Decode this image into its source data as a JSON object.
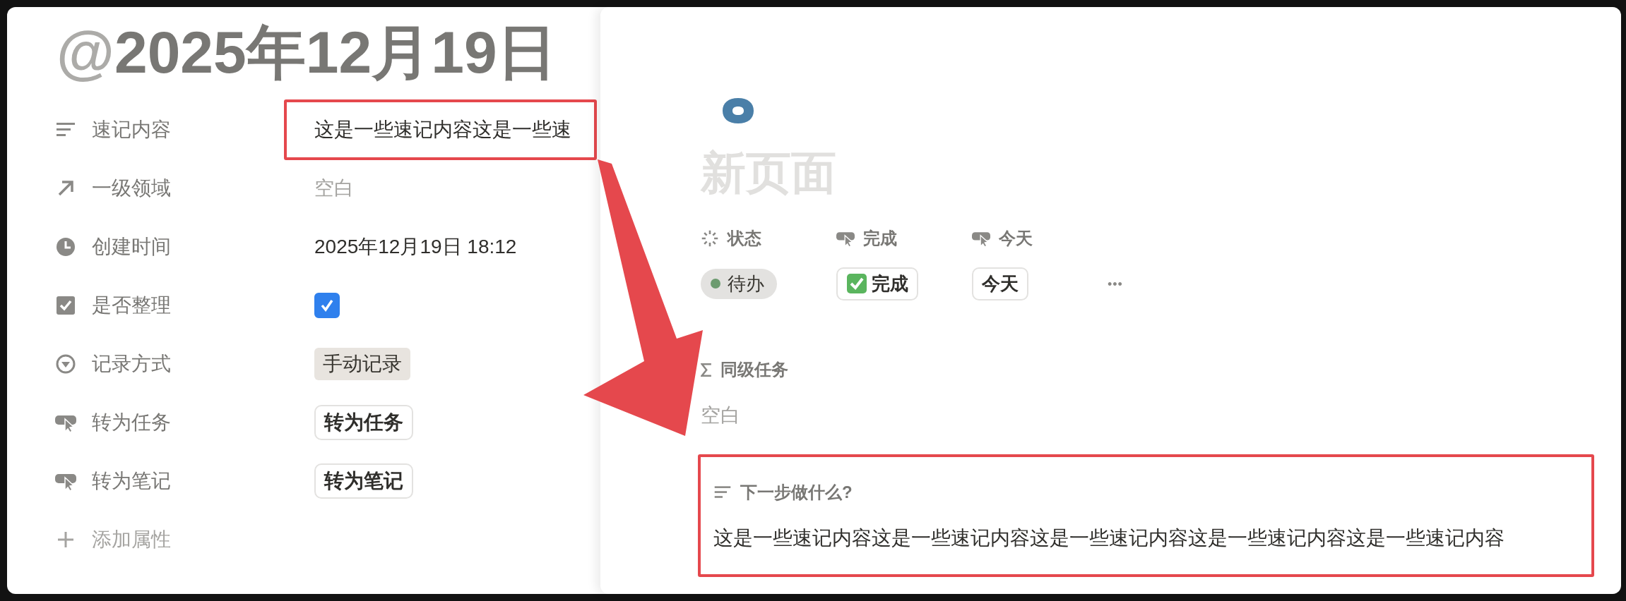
{
  "left_page": {
    "title": {
      "prefix": "@",
      "text": "2025年12月19日"
    },
    "properties": [
      {
        "kind": "text",
        "label": "速记内容",
        "value": "这是一些速记内容这是一些速",
        "highlighted": true
      },
      {
        "kind": "relation",
        "label": "一级领域",
        "value": "空白",
        "empty": true,
        "highlighted": false
      },
      {
        "kind": "created_time",
        "label": "创建时间",
        "value": "2025年12月19日 18:12",
        "highlighted": false
      },
      {
        "kind": "checkbox",
        "label": "是否整理",
        "checked": true,
        "highlighted": false
      },
      {
        "kind": "select",
        "label": "记录方式",
        "value": "手动记录",
        "highlighted": false
      },
      {
        "kind": "button",
        "label": "转为任务",
        "value": "转为任务",
        "highlighted": false
      },
      {
        "kind": "button",
        "label": "转为笔记",
        "value": "转为笔记",
        "highlighted": false
      }
    ],
    "add_property": "添加属性"
  },
  "right_page": {
    "title": "新页面",
    "properties": [
      {
        "kind": "status",
        "label": "状态",
        "value": "待办"
      },
      {
        "kind": "button",
        "label": "完成",
        "value": "完成",
        "check_emoji": true
      },
      {
        "kind": "button",
        "label": "今天",
        "value": "今天",
        "check_emoji": false
      }
    ],
    "more": "•••",
    "rollup": {
      "label": "同级任务",
      "value": "空白"
    },
    "next_step": {
      "label": "下一步做什么?",
      "value": "这是一些速记内容这是一些速记内容这是一些速记内容这是一些速记内容这是一些速记内容",
      "highlighted": true
    }
  }
}
